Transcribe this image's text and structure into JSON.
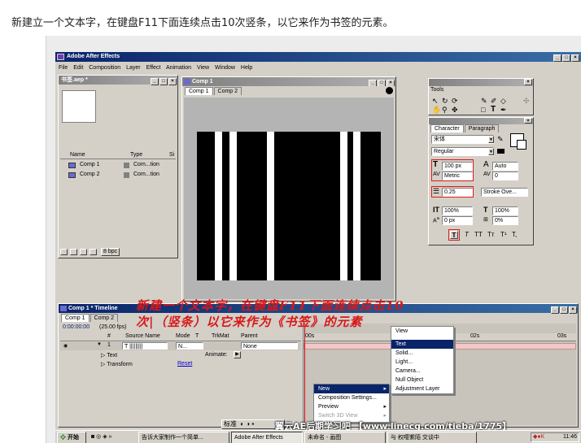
{
  "caption": "新建立一个文本字，在键盘F11下面连续点击10次竖条，以它来作为书签的元素。",
  "app": {
    "title": "Adobe After Effects",
    "menu": [
      "File",
      "Edit",
      "Composition",
      "Layer",
      "Effect",
      "Animation",
      "View",
      "Window",
      "Help"
    ]
  },
  "project": {
    "title": "书签.aep *",
    "cols": {
      "name": "Name",
      "type": "Type",
      "size": "Si"
    },
    "items": [
      {
        "name": "Comp 1",
        "type": "Com...tion"
      },
      {
        "name": "Comp 2",
        "type": "Com...tion"
      }
    ],
    "bpc": "8 bpc"
  },
  "comp": {
    "title": "Comp 1",
    "tabs": [
      "Comp 1",
      "Comp 2"
    ]
  },
  "tools": {
    "title": "Tools",
    "tool_T": "T"
  },
  "character": {
    "tabs": [
      "Character",
      "Paragraph"
    ],
    "font": "宋体",
    "style": "Regular",
    "size": "100 px",
    "leading": "Auto",
    "kerning": "Metric",
    "tracking": "0",
    "stroke_width": "0.25",
    "stroke_mode": "Stroke Ove...",
    "v_scale": "100%",
    "h_scale": "100%",
    "baseline": "0 px",
    "tsume": "0%",
    "style_buttons": [
      "T",
      "T",
      "TT",
      "Tт",
      "T¹",
      "T,"
    ]
  },
  "timeline": {
    "title": "Comp 1 * Timeline",
    "tabs": [
      "Comp 1",
      "Comp 2"
    ],
    "timecode": "0:00:00:00",
    "fps": "(25.00 fps)",
    "headers": [
      "#",
      "Source Name",
      "Mode",
      "T",
      "TrkMat",
      "Parent"
    ],
    "layer": {
      "num": "1",
      "name": "T |||||||||",
      "mode": "N...",
      "parent": "None"
    },
    "sub_text": "Text",
    "animate": "Animate:",
    "sub_transform": "Transform",
    "reset": "Reset",
    "ruler": [
      "00s",
      "02s",
      "03s"
    ]
  },
  "annotation": {
    "line1": "新建一个文本字，在键盘F11下面连续点击10",
    "line2": "次|（竖条）以它来作为《书签》的元素"
  },
  "context_menu": {
    "items": [
      "New",
      "Composition Settings...",
      "Preview",
      "Switch 3D View"
    ]
  },
  "submenu": {
    "items": [
      "View",
      "Text",
      "Solid...",
      "Light...",
      "Camera...",
      "Null Object",
      "Adjustment Layer"
    ]
  },
  "taskbar": {
    "start": "开始",
    "items": [
      "告诉大家制作一个简单...",
      "Adobe After Effects",
      "未命名 - 画图",
      "与 权嘤紫陌 交谈中"
    ],
    "ime": "标准",
    "clock": "11:46"
  },
  "watermark": "翼云AE后期学习吧 【www.linecg.com/tieba/1775】"
}
